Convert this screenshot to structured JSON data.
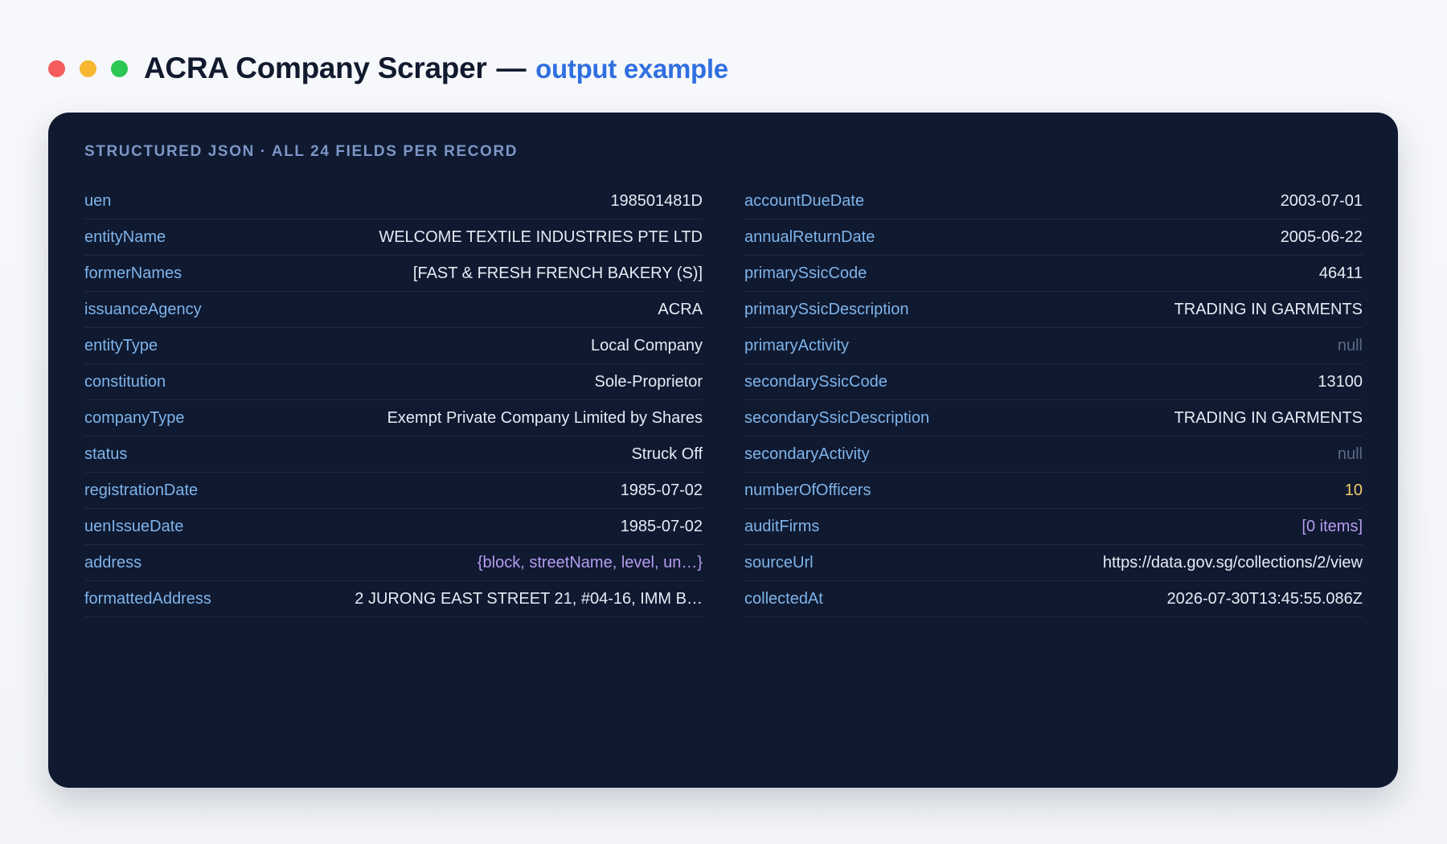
{
  "header": {
    "title": "ACRA Company Scraper",
    "separator": "—",
    "subtitle": "output example"
  },
  "panel": {
    "caption": "STRUCTURED JSON · ALL 24 FIELDS PER RECORD"
  },
  "left_fields": [
    {
      "key": "uen",
      "value": "198501481D"
    },
    {
      "key": "entityName",
      "value": "WELCOME TEXTILE INDUSTRIES PTE LTD"
    },
    {
      "key": "formerNames",
      "value": "[FAST & FRESH FRENCH BAKERY (S)]"
    },
    {
      "key": "issuanceAgency",
      "value": "ACRA"
    },
    {
      "key": "entityType",
      "value": "Local Company"
    },
    {
      "key": "constitution",
      "value": "Sole-Proprietor"
    },
    {
      "key": "companyType",
      "value": "Exempt Private Company Limited by Shares"
    },
    {
      "key": "status",
      "value": "Struck Off"
    },
    {
      "key": "registrationDate",
      "value": "1985-07-02"
    },
    {
      "key": "uenIssueDate",
      "value": "1985-07-02"
    },
    {
      "key": "address",
      "value": "{block, streetName, level, un…}"
    },
    {
      "key": "formattedAddress",
      "value": "2 JURONG EAST STREET 21, #04-16, IMM B…"
    }
  ],
  "right_fields": [
    {
      "key": "accountDueDate",
      "value": "2003-07-01"
    },
    {
      "key": "annualReturnDate",
      "value": "2005-06-22"
    },
    {
      "key": "primarySsicCode",
      "value": "46411"
    },
    {
      "key": "primarySsicDescription",
      "value": "TRADING IN GARMENTS"
    },
    {
      "key": "primaryActivity",
      "value": "null"
    },
    {
      "key": "secondarySsicCode",
      "value": "13100"
    },
    {
      "key": "secondarySsicDescription",
      "value": "TRADING IN GARMENTS"
    },
    {
      "key": "secondaryActivity",
      "value": "null"
    },
    {
      "key": "numberOfOfficers",
      "value": "10"
    },
    {
      "key": "auditFirms",
      "value": "[0 items]"
    },
    {
      "key": "sourceUrl",
      "value": "https://data.gov.sg/collections/2/view"
    },
    {
      "key": "collectedAt",
      "value": "2026-07-30T13:45:55.086Z"
    }
  ],
  "colors": {
    "panel_bg": "#0f1930",
    "key": "#7fb4ea",
    "value": "#e6ebf4",
    "null": "#5b6a85",
    "number": "#f4cb6b",
    "object": "#b79cf0",
    "accent": "#2f6fe0"
  },
  "icons": [
    "close-dot-icon",
    "minimize-dot-icon",
    "maximize-dot-icon"
  ]
}
